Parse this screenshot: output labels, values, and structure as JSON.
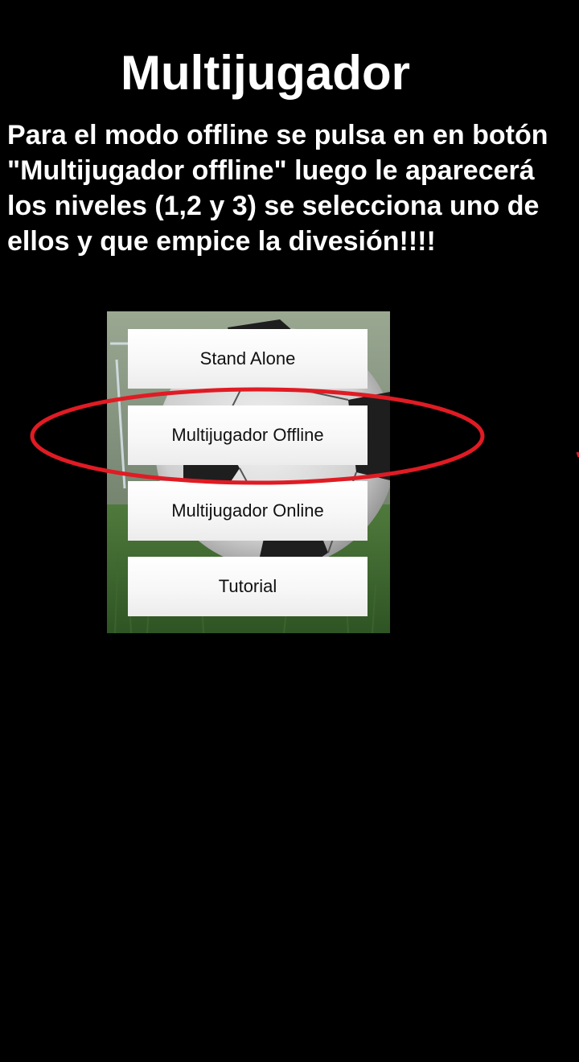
{
  "page": {
    "title": "Multijugador",
    "instructions": "Para el modo offline se pulsa en en botón \"Multijugador offline\" luego le aparecerá los niveles (1,2 y 3) se selecciona uno de ellos y que empice la divesión!!!!"
  },
  "menu": {
    "buttons": [
      {
        "label": "Stand Alone"
      },
      {
        "label": "Multijugador Offline"
      },
      {
        "label": "Multijugador Online"
      },
      {
        "label": "Tutorial"
      }
    ]
  },
  "colors": {
    "background": "#000000",
    "text": "#ffffff",
    "highlight": "#e01b24",
    "button": "#f5f5f5",
    "button_text": "#111111"
  },
  "annotations": {
    "highlight_shape": "ellipse",
    "highlighted_item": "Multijugador Offline"
  }
}
